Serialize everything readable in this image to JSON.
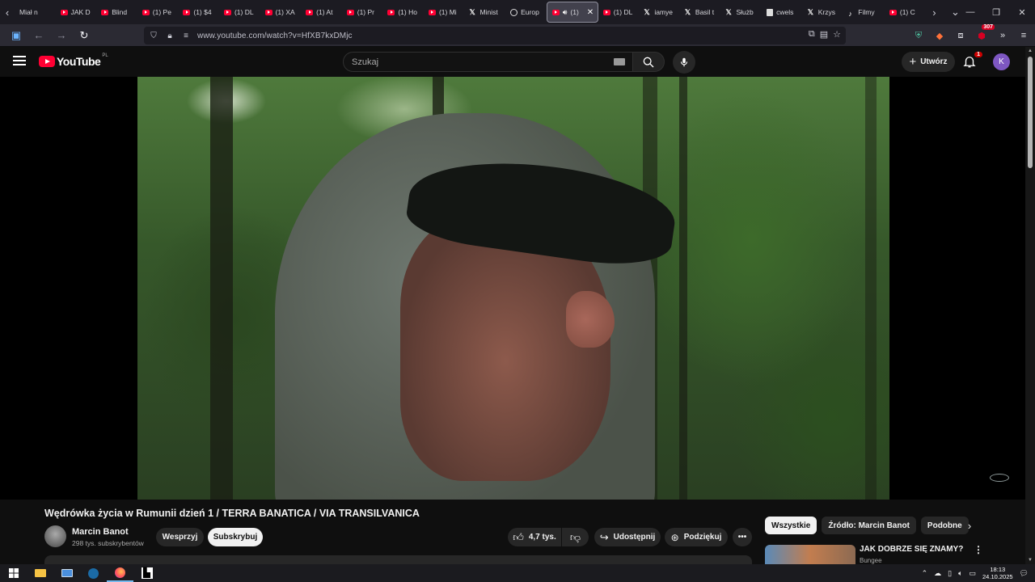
{
  "browser": {
    "tabs": [
      {
        "label": "Miał n",
        "icon": "none"
      },
      {
        "label": "JAK D",
        "icon": "youtube-icon"
      },
      {
        "label": "Blind",
        "icon": "youtube-icon"
      },
      {
        "label": "(1) Pe",
        "icon": "youtube-icon"
      },
      {
        "label": "(1) $4",
        "icon": "youtube-icon"
      },
      {
        "label": "(1) DL",
        "icon": "youtube-icon"
      },
      {
        "label": "(1) XA",
        "icon": "youtube-icon"
      },
      {
        "label": "(1) At",
        "icon": "youtube-icon"
      },
      {
        "label": "(1) Pr",
        "icon": "youtube-icon"
      },
      {
        "label": "(1) Ho",
        "icon": "youtube-icon"
      },
      {
        "label": "(1) Mi",
        "icon": "youtube-icon"
      },
      {
        "label": "Minist",
        "icon": "x-icon"
      },
      {
        "label": "Europ",
        "icon": "globe-icon"
      },
      {
        "label": "(1) ",
        "icon": "youtube-icon",
        "active": true
      },
      {
        "label": "(1) DL",
        "icon": "youtube-icon"
      },
      {
        "label": "iamye",
        "icon": "x-icon"
      },
      {
        "label": "Basil t",
        "icon": "x-icon"
      },
      {
        "label": "Służb",
        "icon": "x-icon"
      },
      {
        "label": "cwels",
        "icon": "doc-icon"
      },
      {
        "label": "Krzys",
        "icon": "x-icon"
      },
      {
        "label": "Filmy",
        "icon": "tiktok-icon"
      },
      {
        "label": "(1) C",
        "icon": "youtube-icon"
      }
    ],
    "url": "www.youtube.com/watch?v=HfXB7kxDMjc",
    "extension_badge": "307"
  },
  "youtube": {
    "logo_text": "YouTube",
    "region": "PL",
    "search_placeholder": "Szukaj",
    "create_label": "Utwórz",
    "notification_count": "1",
    "avatar_letter": "K"
  },
  "video": {
    "title": "Wędrówka życia w Rumunii dzień 1 / TERRA BANATICA / VIA TRANSILVANICA",
    "channel": "Marcin Banot",
    "subscribers": "298 tys. subskrybentów",
    "support_label": "Wesprzyj",
    "subscribe_label": "Subskrybuj",
    "likes": "4,7 tys.",
    "share_label": "Udostępnij",
    "thanks_label": "Podziękuj"
  },
  "sidebar": {
    "chips": [
      "Wszystkie",
      "Źródło: Marcin Banot",
      "Podobne"
    ],
    "recommendation": {
      "title": "JAK DOBRZE SIĘ ZNAMY?",
      "channel": "Bungee"
    }
  },
  "taskbar": {
    "time": "18:13",
    "date": "24.10.2025"
  },
  "colors": {
    "accent": "#ff0033",
    "avatar": "#7e57c2"
  }
}
